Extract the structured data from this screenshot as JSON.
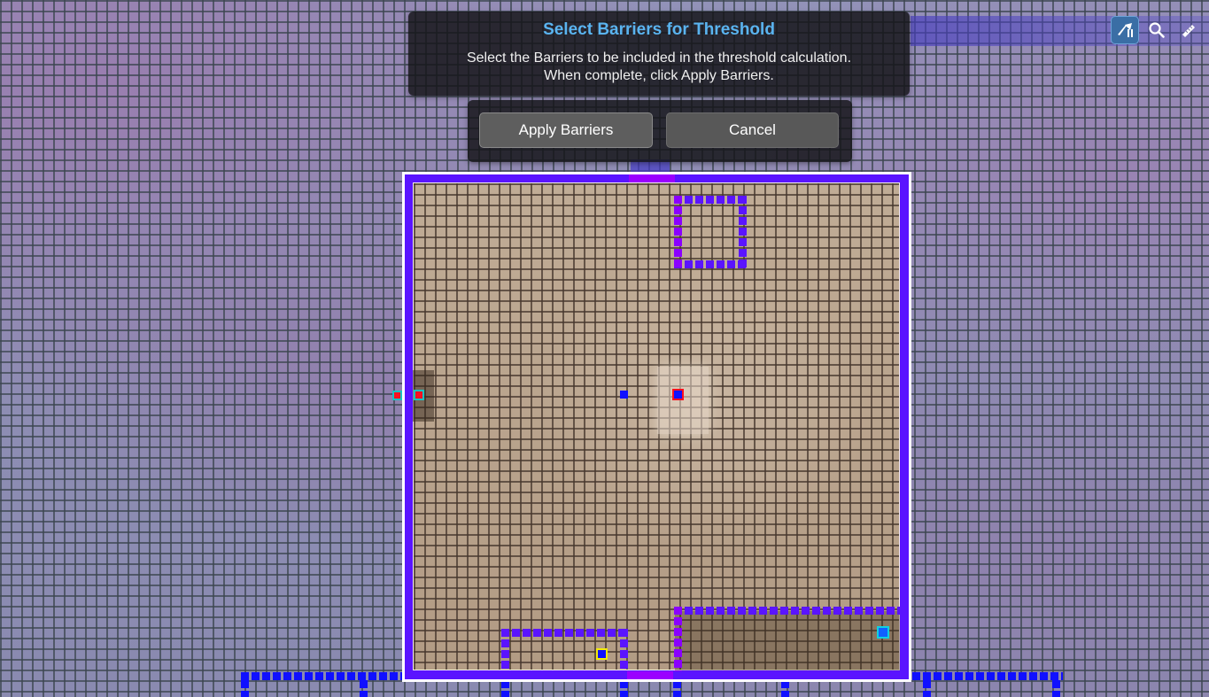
{
  "dialog": {
    "title": "Select Barriers for Threshold",
    "line1": "Select the Barriers to be included in the threshold calculation.",
    "line2": "When complete, click Apply Barriers."
  },
  "buttons": {
    "apply_label": "Apply Barriers",
    "cancel_label": "Cancel"
  },
  "toolbar": {
    "tools": [
      {
        "icon": "wall-select-icon",
        "active": true
      },
      {
        "icon": "search-icon",
        "active": false
      },
      {
        "icon": "ruler-icon",
        "active": false
      }
    ]
  },
  "colors": {
    "barrier": "#5a14ff",
    "door": "#9a00ff",
    "outer_wall": "#1010ff",
    "dialog_title": "#5ab4f0",
    "active_tool": "#3a6ea5"
  }
}
